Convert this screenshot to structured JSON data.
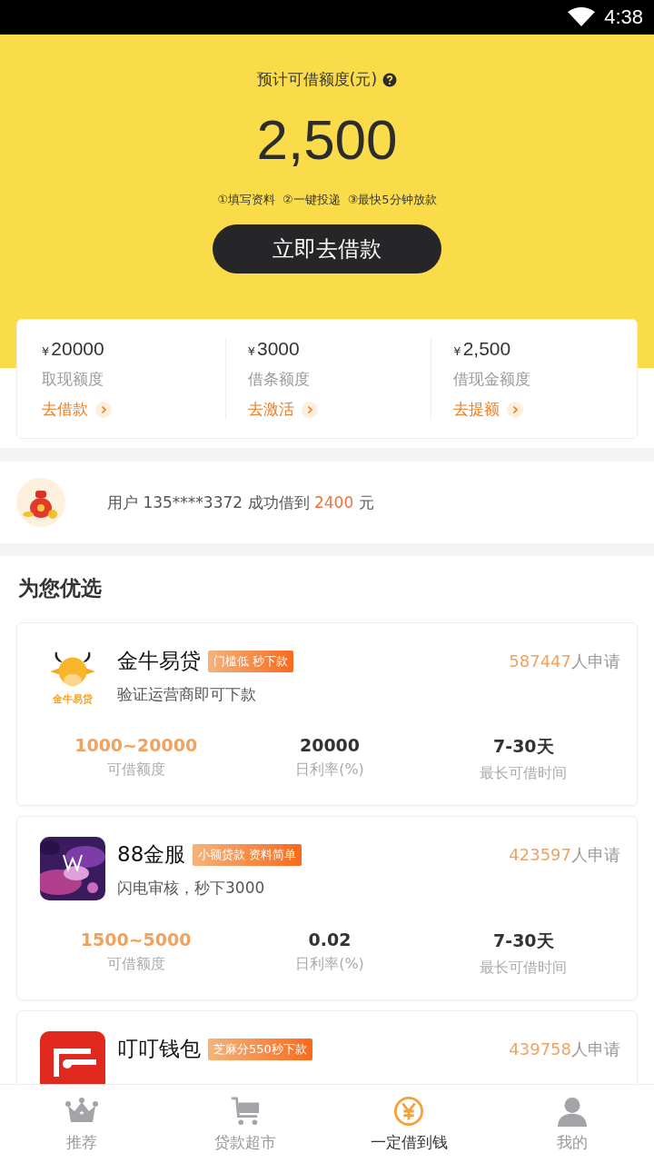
{
  "status_bar": {
    "time": "4:38"
  },
  "hero": {
    "title": "预计可借额度(元)",
    "amount": "2,500",
    "steps": [
      "①填写资料",
      "②一键投递",
      "③最快5分钟放款"
    ],
    "button": "立即去借款"
  },
  "quotas": [
    {
      "currency": "¥",
      "amount": "20000",
      "label": "取现额度",
      "action": "去借款"
    },
    {
      "currency": "¥",
      "amount": "3000",
      "label": "借条额度",
      "action": "去激活"
    },
    {
      "currency": "¥",
      "amount": "2,500",
      "label": "借现金额度",
      "action": "去提额"
    }
  ],
  "ticker": {
    "prefix": "用户 135****3372 成功借到 ",
    "amount": "2400",
    "suffix": " 元"
  },
  "section_title": "为您优选",
  "products": [
    {
      "name": "金牛易贷",
      "logo_text": "金牛易贷",
      "tag": "门槛低 秒下款",
      "subtitle": "验证运营商即可下款",
      "count": "587447",
      "count_suffix": "人申请",
      "stats": [
        {
          "value": "1000~20000",
          "label": "可借额度",
          "highlight": true
        },
        {
          "value": "20000",
          "label": "日利率(%)",
          "highlight": false
        },
        {
          "value": "7-30天",
          "label": "最长可借时间",
          "highlight": false
        }
      ]
    },
    {
      "name": "88金服",
      "tag": "小额贷款 资料简单",
      "subtitle": "闪电审核，秒下3000",
      "count": "423597",
      "count_suffix": "人申请",
      "stats": [
        {
          "value": "1500~5000",
          "label": "可借额度",
          "highlight": true
        },
        {
          "value": "0.02",
          "label": "日利率(%)",
          "highlight": false
        },
        {
          "value": "7-30天",
          "label": "最长可借时间",
          "highlight": false
        }
      ]
    },
    {
      "name": "叮叮钱包",
      "tag": "芝麻分550秒下款",
      "count": "439758",
      "count_suffix": "人申请"
    }
  ],
  "tab_bar": [
    {
      "label": "推荐",
      "selected": false
    },
    {
      "label": "贷款超市",
      "selected": false
    },
    {
      "label": "一定借到钱",
      "selected": true
    },
    {
      "label": "我的",
      "selected": false
    }
  ]
}
